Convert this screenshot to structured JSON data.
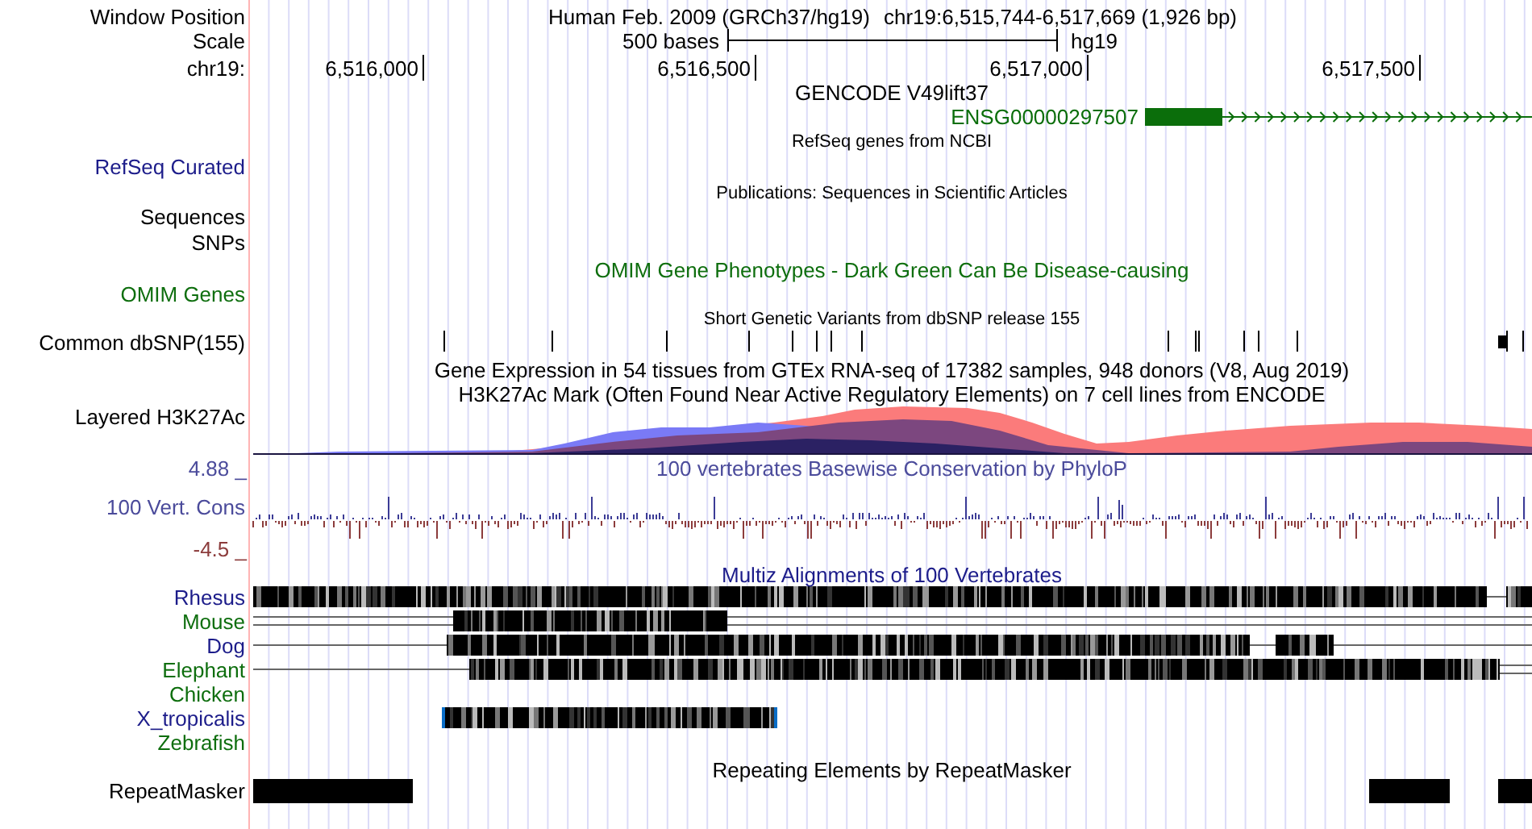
{
  "header": {
    "window_label": "Window Position",
    "title": "Human Feb. 2009 (GRCh37/hg19)",
    "position": "chr19:6,515,744-6,517,669 (1,926 bp)",
    "scale_label": "Scale",
    "scale_text": "500 bases",
    "assembly": "hg19",
    "chrom_label": "chr19:",
    "ticks": [
      "6,516,000",
      "6,516,500",
      "6,517,000",
      "6,517,500"
    ]
  },
  "tracks": [
    {
      "kind": "gene",
      "title": {
        "text": "GENCODE V49lift37",
        "color": "#000000"
      },
      "feature": {
        "text": "ENSG00000297507",
        "color": "#0b6e0b"
      }
    },
    {
      "kind": "refseq",
      "label": {
        "text": "RefSeq Curated",
        "color": "#1c1c8a"
      },
      "title": {
        "text": "RefSeq genes from NCBI",
        "color": "#000000"
      }
    },
    {
      "kind": "publications",
      "label": {
        "text": "Sequences",
        "color": "#000000"
      },
      "title": {
        "text": "Publications: Sequences in Scientific Articles",
        "color": "#000000"
      }
    },
    {
      "kind": "snps",
      "label": {
        "text": "SNPs",
        "color": "#000000"
      }
    },
    {
      "kind": "omim",
      "label": {
        "text": "OMIM Genes",
        "color": "#0e6e0e"
      },
      "title": {
        "text": "OMIM Gene Phenotypes - Dark Green Can Be Disease-causing",
        "color": "#0e6e0e"
      }
    },
    {
      "kind": "dbsnp",
      "label": {
        "text": "Common dbSNP(155)",
        "color": "#000000"
      },
      "title": {
        "text": "Short Genetic Variants from dbSNP release 155",
        "color": "#000000"
      }
    },
    {
      "kind": "gtex",
      "title": {
        "text": "Gene Expression in 54 tissues from GTEx RNA-seq of 17382 samples, 948 donors (V8, Aug 2019)",
        "color": "#000000"
      }
    },
    {
      "kind": "layered",
      "label": {
        "text": "Layered H3K27Ac",
        "color": "#000000"
      },
      "title": {
        "text": "H3K27Ac Mark (Often Found Near Active Regulatory Elements) on 7 cell lines from ENCODE",
        "color": "#000000"
      }
    },
    {
      "kind": "phylop",
      "label": {
        "text": "100 Vert. Cons",
        "color": "#4b4b9b"
      },
      "title": {
        "text": "100 vertebrates Basewise Conservation by PhyloP",
        "color": "#4b4b9b"
      },
      "axis_max": {
        "text": "4.88 _",
        "color": "#4b4b9b"
      },
      "axis_min": {
        "text": "-4.5 _",
        "color": "#8c3c3c"
      }
    },
    {
      "kind": "multiz",
      "title": {
        "text": "Multiz Alignments of 100 Vertebrates",
        "color": "#1c1c8a"
      },
      "species": [
        {
          "text": "Rhesus",
          "color": "#1c1c8a"
        },
        {
          "text": "Mouse",
          "color": "#0e6e0e"
        },
        {
          "text": "Dog",
          "color": "#1c1c8a"
        },
        {
          "text": "Elephant",
          "color": "#0e6e0e"
        },
        {
          "text": "Chicken",
          "color": "#0e6e0e"
        },
        {
          "text": "X_tropicalis",
          "color": "#1c1c8a"
        },
        {
          "text": "Zebrafish",
          "color": "#0e6e0e"
        }
      ]
    },
    {
      "kind": "repeats",
      "label": {
        "text": "RepeatMasker",
        "color": "#000000"
      },
      "title": {
        "text": "Repeating Elements by RepeatMasker",
        "color": "#000000"
      }
    }
  ]
}
